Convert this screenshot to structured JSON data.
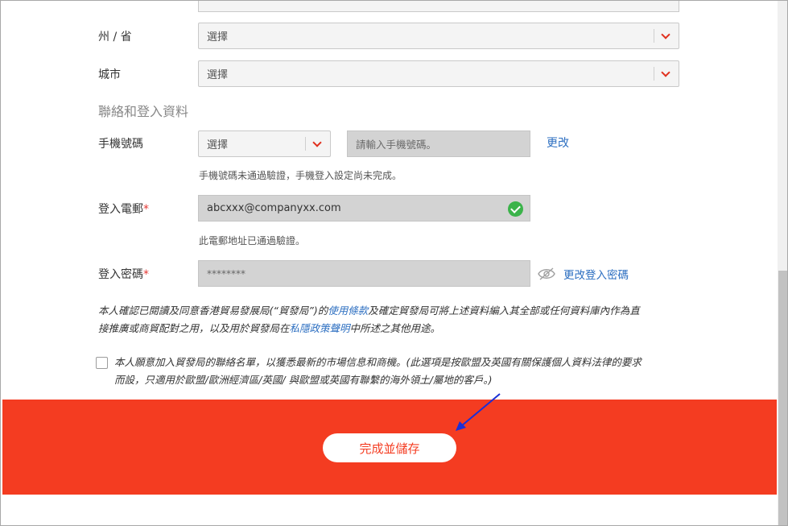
{
  "form": {
    "state": {
      "label": "州 / 省",
      "value": "選擇"
    },
    "city": {
      "label": "城市",
      "value": "選擇"
    },
    "section_title": "聯絡和登入資料",
    "mobile": {
      "label": "手機號碼",
      "country_value": "選擇",
      "number_placeholder": "請輸入手機號碼。",
      "change_link": "更改",
      "hint": "手機號碼未通過驗證，手機登入設定尚未完成。"
    },
    "email": {
      "label": "登入電郵",
      "required_mark": "*",
      "value": "abcxxx@companyxx.com",
      "hint": "此電郵地址已通過驗證。"
    },
    "password": {
      "label": "登入密碼",
      "required_mark": "*",
      "value": "********",
      "change_link": "更改登入密碼"
    },
    "consent": {
      "text_1": "本人確認已閱讀及同意香港貿易發展局(“貿發局”)的",
      "terms_link": "使用條款",
      "text_2": "及確定貿發局可將上述資料編入其全部或任何資料庫內作為直",
      "text_3": "接推廣或商貿配對之用，以及用於貿發局在",
      "privacy_link": "私隱政策聲明",
      "text_4": "中所述之其他用途。"
    },
    "opt_in": {
      "line_1": "本人願意加入貿發局的聯絡名單，以獲悉最新的市場信息和商機。(此選項是按歐盟及英國有關保護個人資料法律的要求",
      "line_2": "而設，只適用於歐盟/歐洲經濟區/英國/ 與歐盟或英國有聯繫的海外領土/屬地的客戶。)"
    }
  },
  "footer": {
    "save_label": "完成並儲存"
  },
  "colors": {
    "accent": "#f43c21",
    "link": "#2d6fc1",
    "success": "#3bb34a",
    "annotation_arrow": "#1a2fd6"
  }
}
